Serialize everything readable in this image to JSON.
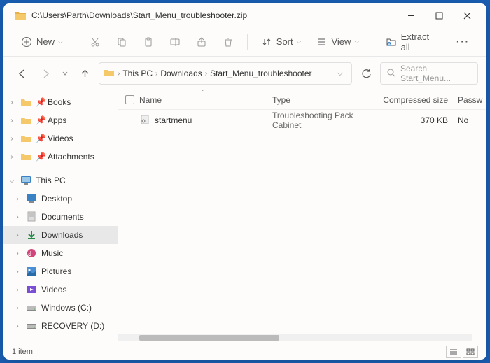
{
  "titlebar": {
    "path": "C:\\Users\\Parth\\Downloads\\Start_Menu_troubleshooter.zip"
  },
  "toolbar": {
    "new": "New",
    "sort": "Sort",
    "view": "View",
    "extract": "Extract all"
  },
  "breadcrumb": {
    "root": "This PC",
    "p1": "Downloads",
    "p2": "Start_Menu_troubleshooter"
  },
  "search": {
    "placeholder": "Search Start_Menu..."
  },
  "sidebar": {
    "quick": [
      {
        "chev": "›",
        "name": "Books",
        "pinned": true,
        "icon": "folder"
      },
      {
        "chev": "›",
        "name": "Apps",
        "pinned": true,
        "icon": "folder"
      },
      {
        "chev": "›",
        "name": "Videos",
        "pinned": true,
        "icon": "folder"
      },
      {
        "chev": "›",
        "name": "Attachments",
        "pinned": true,
        "icon": "folder"
      }
    ],
    "pc_label": "This PC",
    "pc": [
      {
        "chev": "›",
        "name": "Desktop",
        "icon": "desktop"
      },
      {
        "chev": "›",
        "name": "Documents",
        "icon": "documents"
      },
      {
        "chev": "›",
        "name": "Downloads",
        "icon": "downloads",
        "selected": true
      },
      {
        "chev": "›",
        "name": "Music",
        "icon": "music"
      },
      {
        "chev": "›",
        "name": "Pictures",
        "icon": "pictures"
      },
      {
        "chev": "›",
        "name": "Videos",
        "icon": "videos"
      },
      {
        "chev": "›",
        "name": "Windows (C:)",
        "icon": "drive"
      },
      {
        "chev": "›",
        "name": "RECOVERY (D:)",
        "icon": "drive"
      }
    ]
  },
  "columns": {
    "name": "Name",
    "type": "Type",
    "size": "Compressed size",
    "pass": "Passw"
  },
  "files": [
    {
      "name": "startmenu",
      "type": "Troubleshooting Pack Cabinet",
      "size": "370 KB",
      "pass": "No"
    }
  ],
  "status": {
    "count": "1 item"
  }
}
